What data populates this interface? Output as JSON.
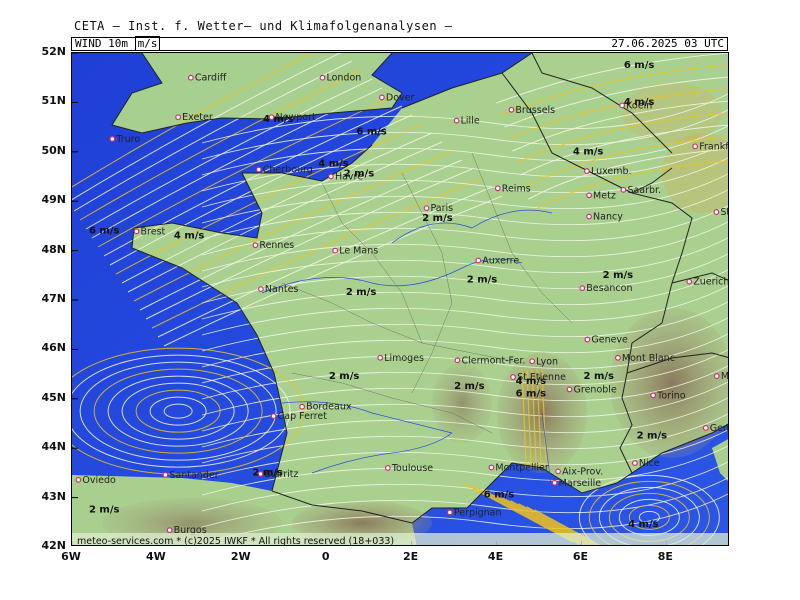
{
  "header": {
    "title": "CETA — Inst. f. Wetter— und Klimafolgenanalysen —",
    "field": "WIND 10m",
    "unit": "m/s",
    "datetime": "27.06.2025 03 UTC"
  },
  "axes": {
    "lat_labels": [
      "52N",
      "51N",
      "50N",
      "49N",
      "48N",
      "47N",
      "46N",
      "45N",
      "44N",
      "43N",
      "42N"
    ],
    "lon_labels": [
      "6W",
      "4W",
      "2W",
      "0",
      "2E",
      "4E",
      "6E",
      "8E"
    ]
  },
  "colors": {
    "sea_fast": "#1f3fd6",
    "land_calm": "#9ec98a",
    "land_mid": "#b9d89b",
    "mountain": "#8f8062",
    "streamline": "#f3f6e6",
    "streamline_fast": "#f0c21c",
    "city_marker": "#d0306a"
  },
  "cities": [
    {
      "name": "Cardiff",
      "lon": -3.2,
      "lat": 51.5
    },
    {
      "name": "London",
      "lon": -0.1,
      "lat": 51.5
    },
    {
      "name": "Dover",
      "lon": 1.3,
      "lat": 51.1
    },
    {
      "name": "Exeter",
      "lon": -3.5,
      "lat": 50.7
    },
    {
      "name": "Truro",
      "lon": -5.05,
      "lat": 50.26
    },
    {
      "name": "Newport",
      "lon": -1.3,
      "lat": 50.7
    },
    {
      "name": "Cherbourg",
      "lon": -1.6,
      "lat": 49.64
    },
    {
      "name": "Brest",
      "lon": -4.48,
      "lat": 48.39
    },
    {
      "name": "Havre",
      "lon": 0.1,
      "lat": 49.5
    },
    {
      "name": "Lille",
      "lon": 3.06,
      "lat": 50.63
    },
    {
      "name": "Brussels",
      "lon": 4.35,
      "lat": 50.85
    },
    {
      "name": "Koeln",
      "lon": 6.96,
      "lat": 50.94
    },
    {
      "name": "Frankfurt",
      "lon": 8.68,
      "lat": 50.11
    },
    {
      "name": "Luxemb.",
      "lon": 6.13,
      "lat": 49.61
    },
    {
      "name": "Saarbr.",
      "lon": 6.99,
      "lat": 49.23
    },
    {
      "name": "Metz",
      "lon": 6.18,
      "lat": 49.12
    },
    {
      "name": "Reims",
      "lon": 4.03,
      "lat": 49.26
    },
    {
      "name": "Paris",
      "lon": 2.35,
      "lat": 48.86
    },
    {
      "name": "Nancy",
      "lon": 6.18,
      "lat": 48.69
    },
    {
      "name": "Stuttgart",
      "lon": 9.18,
      "lat": 48.78
    },
    {
      "name": "Rennes",
      "lon": -1.68,
      "lat": 48.11
    },
    {
      "name": "Le Mans",
      "lon": 0.2,
      "lat": 48.0
    },
    {
      "name": "Auxerre",
      "lon": 3.57,
      "lat": 47.8
    },
    {
      "name": "Nantes",
      "lon": -1.55,
      "lat": 47.22
    },
    {
      "name": "Besancon",
      "lon": 6.02,
      "lat": 47.24
    },
    {
      "name": "Zuerich",
      "lon": 8.54,
      "lat": 47.37
    },
    {
      "name": "Geneve",
      "lon": 6.14,
      "lat": 46.2
    },
    {
      "name": "Mont Blanc",
      "lon": 6.86,
      "lat": 45.83
    },
    {
      "name": "Limoges",
      "lon": 1.26,
      "lat": 45.83
    },
    {
      "name": "Clermont-Fer.",
      "lon": 3.08,
      "lat": 45.78
    },
    {
      "name": "Lyon",
      "lon": 4.84,
      "lat": 45.76
    },
    {
      "name": "St.Etienne",
      "lon": 4.39,
      "lat": 45.44
    },
    {
      "name": "Milano",
      "lon": 9.19,
      "lat": 45.46
    },
    {
      "name": "Grenoble",
      "lon": 5.72,
      "lat": 45.19
    },
    {
      "name": "Torino",
      "lon": 7.69,
      "lat": 45.07
    },
    {
      "name": "Bordeaux",
      "lon": -0.58,
      "lat": 44.84
    },
    {
      "name": "Cap Ferret",
      "lon": -1.25,
      "lat": 44.65
    },
    {
      "name": "Genova",
      "lon": 8.93,
      "lat": 44.41
    },
    {
      "name": "Nice",
      "lon": 7.26,
      "lat": 43.7
    },
    {
      "name": "Montpellier",
      "lon": 3.88,
      "lat": 43.61
    },
    {
      "name": "Aix-Prov.",
      "lon": 5.45,
      "lat": 43.53
    },
    {
      "name": "Toulouse",
      "lon": 1.44,
      "lat": 43.6
    },
    {
      "name": "Biarritz",
      "lon": -1.56,
      "lat": 43.48
    },
    {
      "name": "Marseille",
      "lon": 5.37,
      "lat": 43.3
    },
    {
      "name": "Oviedo",
      "lon": -5.85,
      "lat": 43.36
    },
    {
      "name": "Santander",
      "lon": -3.8,
      "lat": 43.46
    },
    {
      "name": "Perpignan",
      "lon": 2.9,
      "lat": 42.7
    },
    {
      "name": "Burgos",
      "lon": -3.7,
      "lat": 42.34
    }
  ],
  "wind_labels": [
    {
      "text": "6 m/s",
      "lon": 7.0,
      "lat": 51.7
    },
    {
      "text": "4 m/s",
      "lon": 7.0,
      "lat": 50.95
    },
    {
      "text": "4 m/s",
      "lon": -1.5,
      "lat": 50.6
    },
    {
      "text": "6 m/s",
      "lon": 0.7,
      "lat": 50.35
    },
    {
      "text": "4 m/s",
      "lon": 5.8,
      "lat": 49.95
    },
    {
      "text": "4 m/s",
      "lon": -0.2,
      "lat": 49.7
    },
    {
      "text": "2 m/s",
      "lon": 0.4,
      "lat": 49.5
    },
    {
      "text": "6 m/s",
      "lon": -5.6,
      "lat": 48.35
    },
    {
      "text": "4 m/s",
      "lon": -3.6,
      "lat": 48.25
    },
    {
      "text": "2 m/s",
      "lon": 2.25,
      "lat": 48.6
    },
    {
      "text": "2 m/s",
      "lon": 6.5,
      "lat": 47.45
    },
    {
      "text": "2 m/s",
      "lon": 3.3,
      "lat": 47.35
    },
    {
      "text": "2 m/s",
      "lon": 0.45,
      "lat": 47.1
    },
    {
      "text": "2 m/s",
      "lon": 0.05,
      "lat": 45.4
    },
    {
      "text": "4 m/s",
      "lon": 4.45,
      "lat": 45.3
    },
    {
      "text": "6 m/s",
      "lon": 4.45,
      "lat": 45.05
    },
    {
      "text": "2 m/s",
      "lon": 3.0,
      "lat": 45.2
    },
    {
      "text": "2 m/s",
      "lon": 6.05,
      "lat": 45.4
    },
    {
      "text": "2 m/s",
      "lon": 7.3,
      "lat": 44.2
    },
    {
      "text": "2 m/s",
      "lon": -1.75,
      "lat": 43.45
    },
    {
      "text": "2 m/s",
      "lon": -5.6,
      "lat": 42.7
    },
    {
      "text": "6 m/s",
      "lon": 3.7,
      "lat": 43.0
    },
    {
      "text": "4 m/s",
      "lon": 7.1,
      "lat": 42.4
    }
  ],
  "credit": "meteo-services.com * (c)2025 IWKF * All rights reserved (18+033)"
}
